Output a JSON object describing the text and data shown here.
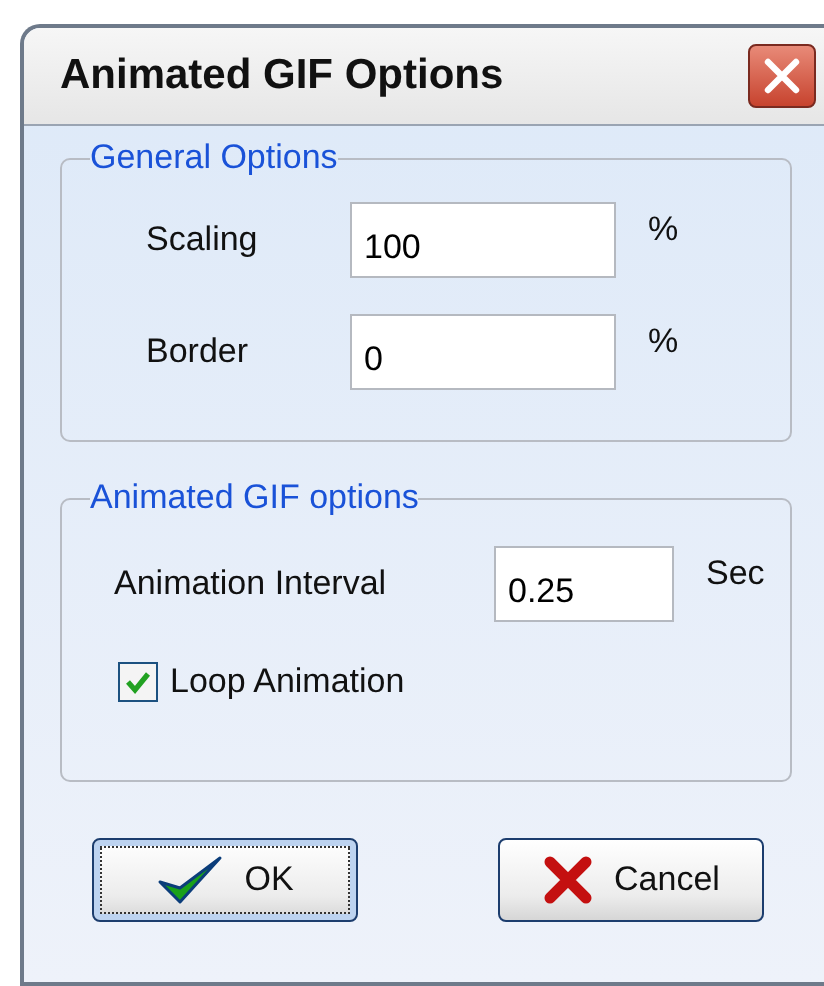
{
  "window": {
    "title": "Animated GIF Options"
  },
  "general_options": {
    "title": "General Options",
    "fields": [
      {
        "label": "Scaling",
        "value": "100",
        "unit": "%"
      },
      {
        "label": "Border",
        "value": "0",
        "unit": "%"
      }
    ]
  },
  "animated_gif_options": {
    "title": "Animated GIF options",
    "fields": [
      {
        "label": "Animation Interval",
        "value": "0.25",
        "unit": "Sec"
      }
    ],
    "checkbox": {
      "label": "Loop Animation",
      "checked": true
    }
  },
  "buttons": [
    {
      "label": "OK",
      "kind": "ok",
      "focused": true
    },
    {
      "label": "Cancel",
      "kind": "cancel",
      "focused": false
    }
  ]
}
